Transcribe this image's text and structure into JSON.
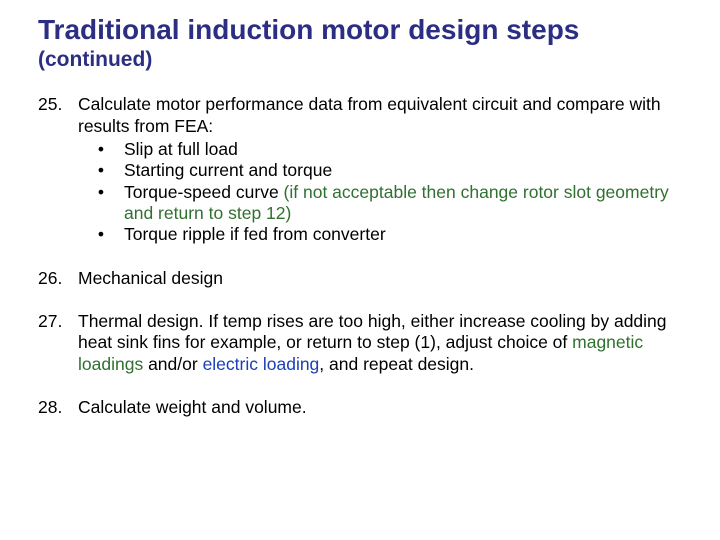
{
  "title": "Traditional induction motor design steps",
  "subtitle": "(continued)",
  "items": [
    {
      "num": "25.",
      "lead": "Calculate motor performance data from equivalent circuit and compare with results from FEA:",
      "subs": [
        {
          "bullet": "•",
          "plain": "Slip at full load"
        },
        {
          "bullet": "•",
          "plain": "Starting current and torque"
        },
        {
          "bullet": "•",
          "plain_before": "Torque-speed curve ",
          "green": "(if not acceptable then change rotor slot geometry and return to step 12)"
        },
        {
          "bullet": "•",
          "plain": "Torque ripple if fed from converter"
        }
      ]
    },
    {
      "num": "26.",
      "lead": "Mechanical design"
    },
    {
      "num": "27.",
      "seg1": "Thermal design. If temp rises are too high, either increase cooling by adding heat sink fins for example, or return to step (1), adjust choice of ",
      "mag": "magnetic loadings",
      "seg2": " and/or ",
      "elec": "electric loading",
      "seg3": ", and repeat design."
    },
    {
      "num": "28.",
      "lead": "Calculate weight and volume."
    }
  ]
}
